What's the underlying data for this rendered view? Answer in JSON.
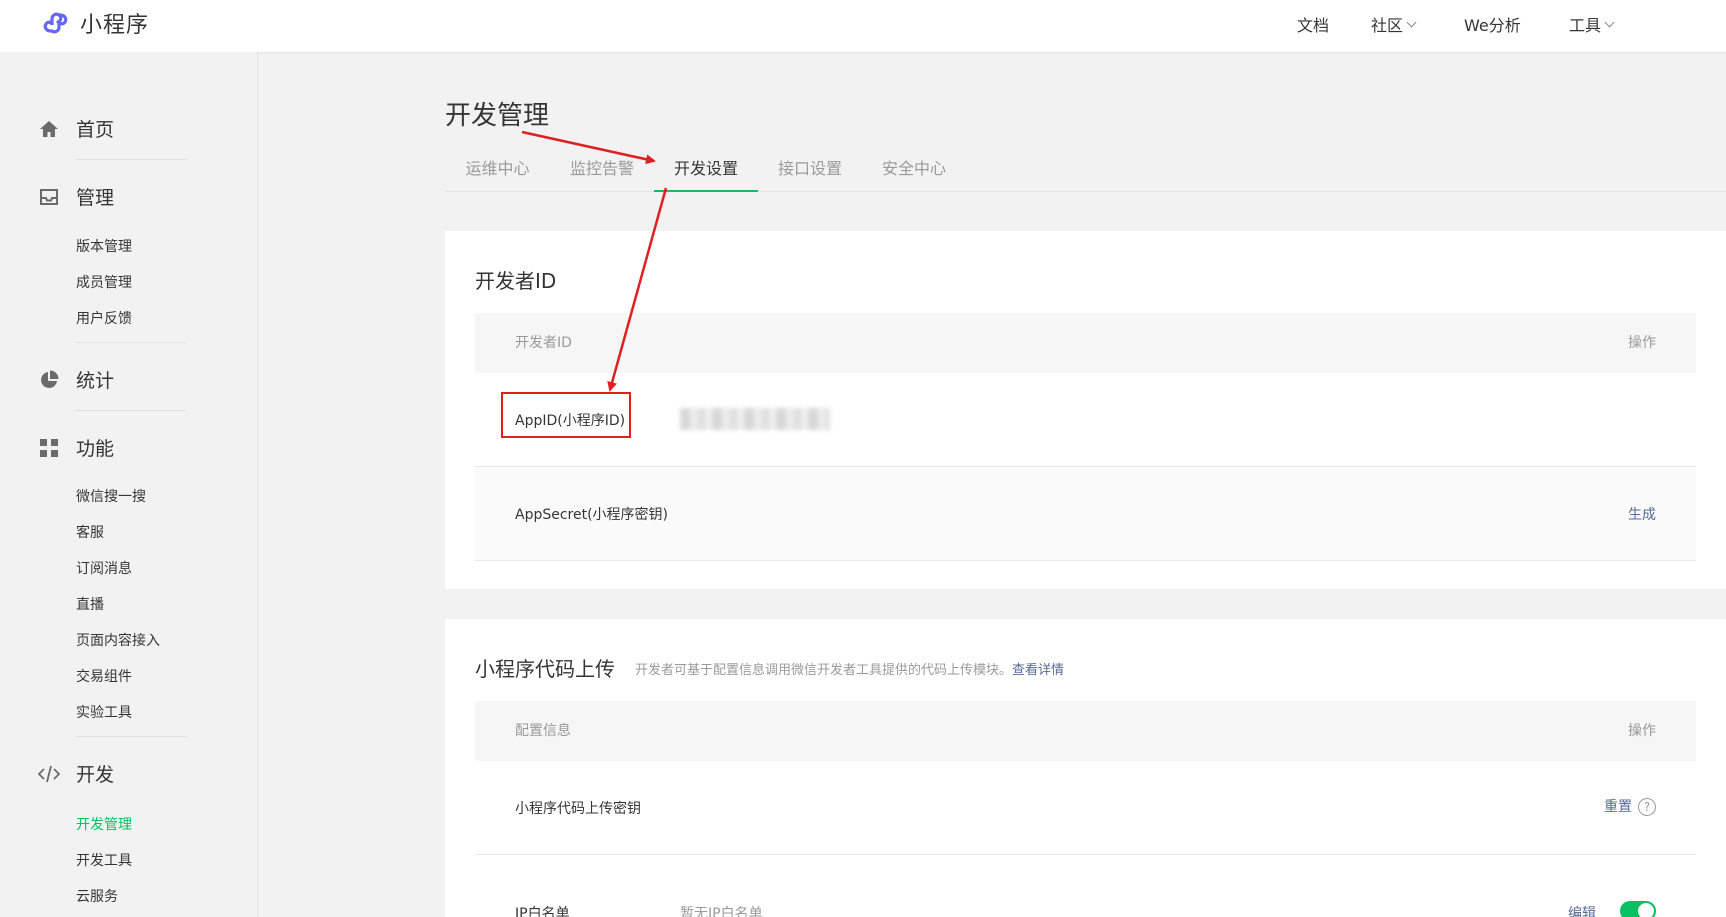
{
  "header": {
    "brand_name": "小程序",
    "nav": [
      {
        "label": "文档",
        "has_dropdown": false
      },
      {
        "label": "社区",
        "has_dropdown": true
      },
      {
        "label": "We分析",
        "has_dropdown": false
      },
      {
        "label": "工具",
        "has_dropdown": true
      }
    ]
  },
  "sidebar": {
    "groups": [
      {
        "label": "首页",
        "icon": "home-icon"
      },
      {
        "label": "管理",
        "icon": "inbox-icon",
        "items": [
          "版本管理",
          "成员管理",
          "用户反馈"
        ]
      },
      {
        "label": "统计",
        "icon": "pie-chart-icon"
      },
      {
        "label": "功能",
        "icon": "grid-icon",
        "items": [
          "微信搜一搜",
          "客服",
          "订阅消息",
          "直播",
          "页面内容接入",
          "交易组件",
          "实验工具"
        ]
      },
      {
        "label": "开发",
        "icon": "code-icon",
        "items": [
          "开发管理",
          "开发工具",
          "云服务"
        ]
      }
    ],
    "active_item": "开发管理"
  },
  "main": {
    "title": "开发管理",
    "tabs": [
      "运维中心",
      "监控告警",
      "开发设置",
      "接口设置",
      "安全中心"
    ],
    "active_tab": "开发设置",
    "developer_id": {
      "title": "开发者ID",
      "columns": [
        "开发者ID",
        "操作"
      ],
      "rows": [
        {
          "name": "AppID(小程序ID)",
          "action": ""
        },
        {
          "name": "AppSecret(小程序密钥)",
          "action": "生成"
        }
      ]
    },
    "code_upload": {
      "title": "小程序代码上传",
      "desc": "开发者可基于配置信息调用微信开发者工具提供的代码上传模块。",
      "desc_link": "查看详情",
      "columns": [
        "配置信息",
        "操作"
      ],
      "rows": [
        {
          "name": "小程序代码上传密钥",
          "value": "",
          "action": "重置",
          "help": "?"
        },
        {
          "name": "IP白名单",
          "value": "暂无IP白名单",
          "action": "编辑",
          "toggle": true
        }
      ]
    }
  },
  "colors": {
    "accent": "#07c160",
    "link": "#576b95",
    "annotation": "#e02020"
  }
}
